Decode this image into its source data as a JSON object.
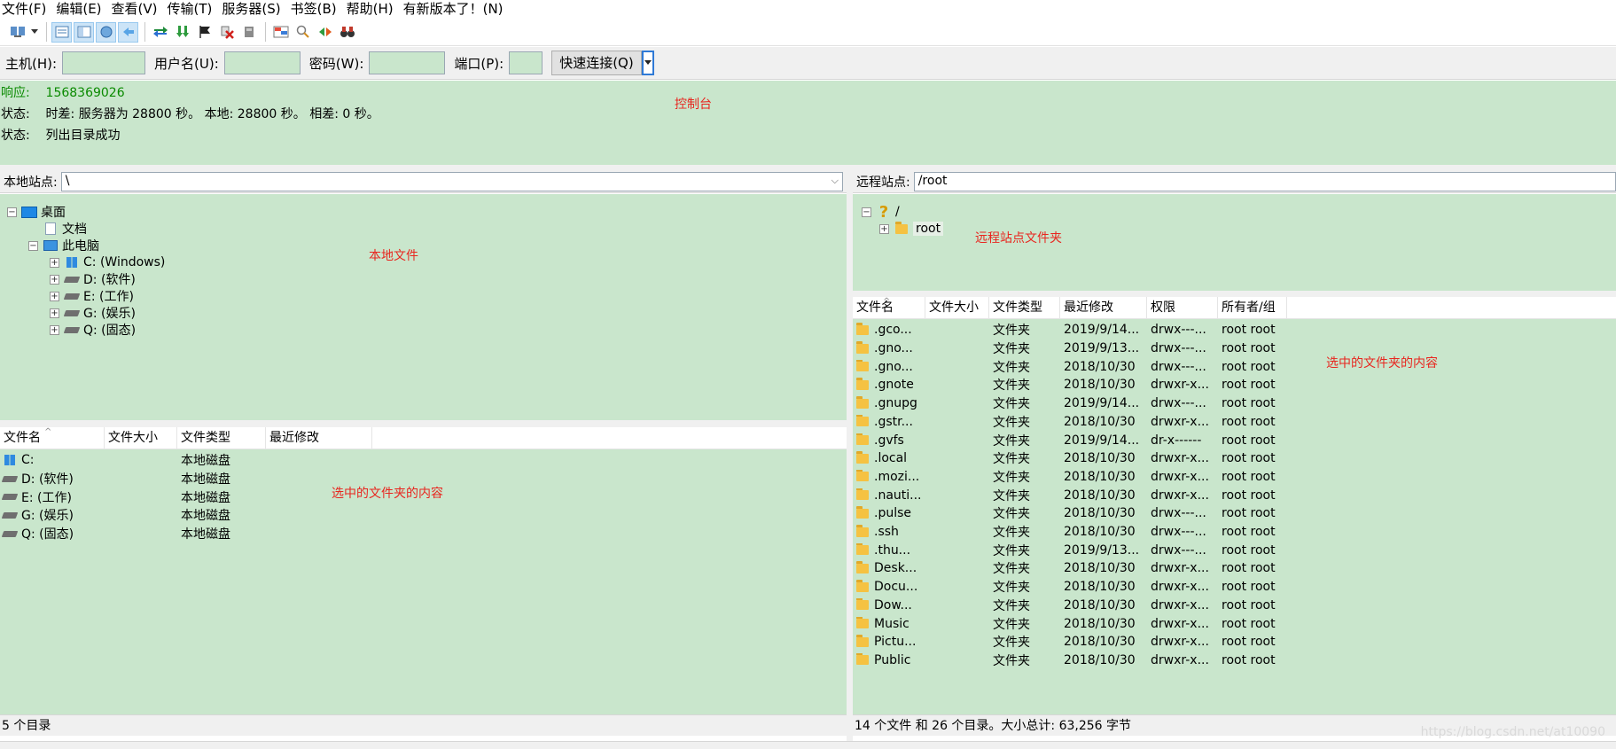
{
  "menu": [
    "文件(F)",
    "编辑(E)",
    "查看(V)",
    "传输(T)",
    "服务器(S)",
    "书签(B)",
    "帮助(H)",
    "有新版本了！(N)"
  ],
  "toolbar": {
    "icons": [
      "site-manager-icon",
      "dropdown-arrow-icon",
      "toggle-log-icon",
      "toggle-local-tree-icon",
      "toggle-remote-tree-icon",
      "toggle-queue-icon",
      "refresh-icon",
      "process-queue-icon",
      "cancel-icon",
      "disconnect-icon",
      "reconnect-icon",
      "directory-compare-icon",
      "sync-browse-icon",
      "search-icon",
      "binoculars-icon"
    ]
  },
  "quickconnect": {
    "host_label": "主机(H):",
    "user_label": "用户名(U):",
    "pass_label": "密码(W):",
    "port_label": "端口(P):",
    "button_label": "快速连接(Q)",
    "host_value": "",
    "user_value": "",
    "pass_value": "",
    "port_value": ""
  },
  "console": {
    "lines": [
      {
        "prefix": "响应:",
        "text": "1568369026",
        "type": "response"
      },
      {
        "prefix": "状态:",
        "text": "时差: 服务器为 28800 秒。 本地: 28800 秒。 相差: 0 秒。",
        "type": "status"
      },
      {
        "prefix": "状态:",
        "text": "列出目录成功",
        "type": "status"
      }
    ]
  },
  "annotations": {
    "console": "控制台",
    "local_files": "本地文件",
    "remote_folders": "远程站点文件夹",
    "local_contents": "选中的文件夹的内容",
    "remote_contents": "选中的文件夹的内容"
  },
  "local": {
    "site_label": "本地站点:",
    "path": "\\",
    "tree": [
      {
        "label": "桌面",
        "icon": "desktop-icon",
        "expander": "−"
      },
      {
        "label": "文档",
        "icon": "document-icon",
        "expander": ""
      },
      {
        "label": "此电脑",
        "icon": "computer-icon",
        "expander": "−"
      },
      {
        "label": "C: (Windows)",
        "icon": "windows-drive-icon",
        "expander": "+"
      },
      {
        "label": "D: (软件)",
        "icon": "drive-icon",
        "expander": "+"
      },
      {
        "label": "E: (工作)",
        "icon": "drive-icon",
        "expander": "+"
      },
      {
        "label": "G: (娱乐)",
        "icon": "drive-icon",
        "expander": "+"
      },
      {
        "label": "Q: (固态)",
        "icon": "drive-icon",
        "expander": "+"
      }
    ],
    "columns": [
      "文件名",
      "文件大小",
      "文件类型",
      "最近修改"
    ],
    "rows": [
      {
        "name": "C:",
        "size": "",
        "type": "本地磁盘",
        "modified": "",
        "icon": "windows-drive-icon"
      },
      {
        "name": "D: (软件)",
        "size": "",
        "type": "本地磁盘",
        "modified": "",
        "icon": "drive-icon"
      },
      {
        "name": "E: (工作)",
        "size": "",
        "type": "本地磁盘",
        "modified": "",
        "icon": "drive-icon"
      },
      {
        "name": "G: (娱乐)",
        "size": "",
        "type": "本地磁盘",
        "modified": "",
        "icon": "drive-icon"
      },
      {
        "name": "Q: (固态)",
        "size": "",
        "type": "本地磁盘",
        "modified": "",
        "icon": "drive-icon"
      }
    ],
    "status": "5 个目录"
  },
  "remote": {
    "site_label": "远程站点:",
    "path": "/root",
    "tree": [
      {
        "label": "/",
        "icon": "unknown-icon",
        "expander": "−"
      },
      {
        "label": "root",
        "icon": "folder-icon",
        "expander": "+"
      }
    ],
    "columns": [
      "文件名",
      "文件大小",
      "文件类型",
      "最近修改",
      "权限",
      "所有者/组"
    ],
    "rows": [
      {
        "name": ".gco...",
        "size": "",
        "type": "文件夹",
        "modified": "2019/9/14...",
        "perms": "drwx---...",
        "owner": "root root"
      },
      {
        "name": ".gno...",
        "size": "",
        "type": "文件夹",
        "modified": "2019/9/13...",
        "perms": "drwx---...",
        "owner": "root root"
      },
      {
        "name": ".gno...",
        "size": "",
        "type": "文件夹",
        "modified": "2018/10/30",
        "perms": "drwx---...",
        "owner": "root root"
      },
      {
        "name": ".gnote",
        "size": "",
        "type": "文件夹",
        "modified": "2018/10/30",
        "perms": "drwxr-x...",
        "owner": "root root"
      },
      {
        "name": ".gnupg",
        "size": "",
        "type": "文件夹",
        "modified": "2019/9/14...",
        "perms": "drwx---...",
        "owner": "root root"
      },
      {
        "name": ".gstr...",
        "size": "",
        "type": "文件夹",
        "modified": "2018/10/30",
        "perms": "drwxr-x...",
        "owner": "root root"
      },
      {
        "name": ".gvfs",
        "size": "",
        "type": "文件夹",
        "modified": "2019/9/14...",
        "perms": "dr-x------",
        "owner": "root root"
      },
      {
        "name": ".local",
        "size": "",
        "type": "文件夹",
        "modified": "2018/10/30",
        "perms": "drwxr-x...",
        "owner": "root root"
      },
      {
        "name": ".mozi...",
        "size": "",
        "type": "文件夹",
        "modified": "2018/10/30",
        "perms": "drwxr-x...",
        "owner": "root root"
      },
      {
        "name": ".nauti...",
        "size": "",
        "type": "文件夹",
        "modified": "2018/10/30",
        "perms": "drwxr-x...",
        "owner": "root root"
      },
      {
        "name": ".pulse",
        "size": "",
        "type": "文件夹",
        "modified": "2018/10/30",
        "perms": "drwx---...",
        "owner": "root root"
      },
      {
        "name": ".ssh",
        "size": "",
        "type": "文件夹",
        "modified": "2018/10/30",
        "perms": "drwx---...",
        "owner": "root root"
      },
      {
        "name": ".thu...",
        "size": "",
        "type": "文件夹",
        "modified": "2019/9/13...",
        "perms": "drwx---...",
        "owner": "root root"
      },
      {
        "name": "Desk...",
        "size": "",
        "type": "文件夹",
        "modified": "2018/10/30",
        "perms": "drwxr-x...",
        "owner": "root root"
      },
      {
        "name": "Docu...",
        "size": "",
        "type": "文件夹",
        "modified": "2018/10/30",
        "perms": "drwxr-x...",
        "owner": "root root"
      },
      {
        "name": "Dow...",
        "size": "",
        "type": "文件夹",
        "modified": "2018/10/30",
        "perms": "drwxr-x...",
        "owner": "root root"
      },
      {
        "name": "Music",
        "size": "",
        "type": "文件夹",
        "modified": "2018/10/30",
        "perms": "drwxr-x...",
        "owner": "root root"
      },
      {
        "name": "Pictu...",
        "size": "",
        "type": "文件夹",
        "modified": "2018/10/30",
        "perms": "drwxr-x...",
        "owner": "root root"
      },
      {
        "name": "Public",
        "size": "",
        "type": "文件夹",
        "modified": "2018/10/30",
        "perms": "drwxr-x...",
        "owner": "root root"
      }
    ],
    "status": "14 个文件 和 26 个目录。大小总计: 63,256 字节"
  },
  "watermark": "https://blog.csdn.net/at10090",
  "colors": {
    "panel_bg": "#c9e6cc",
    "annotation": "#e8261f",
    "response": "#0a8a00"
  }
}
